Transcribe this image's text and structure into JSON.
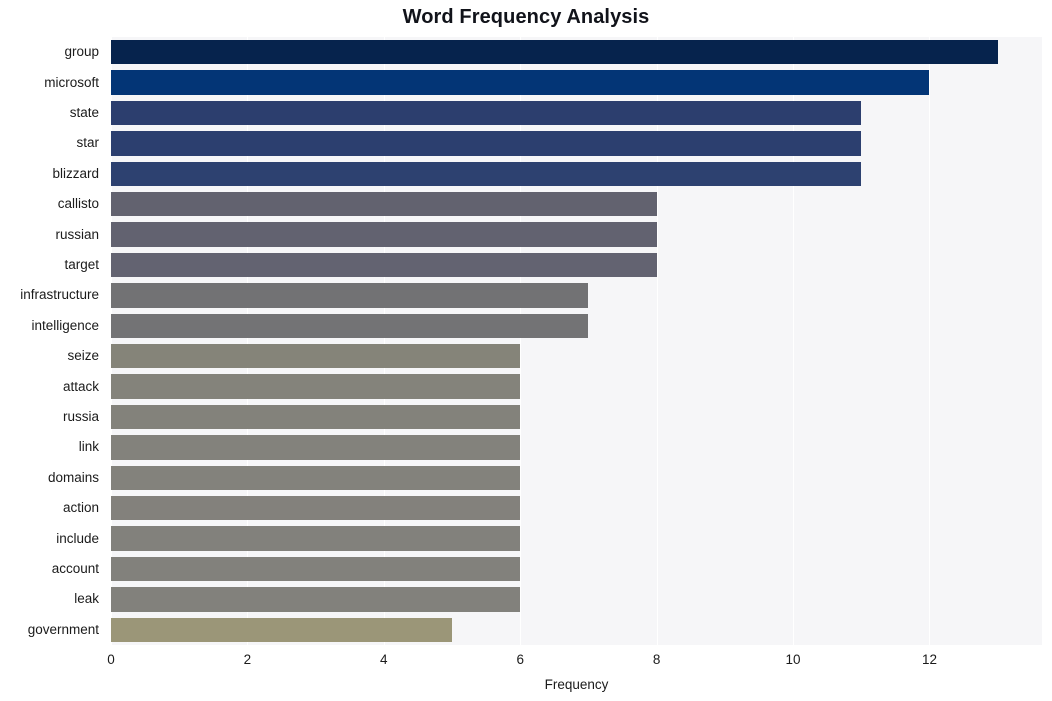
{
  "chart_data": {
    "type": "bar",
    "orientation": "horizontal",
    "title": "Word Frequency Analysis",
    "xlabel": "Frequency",
    "ylabel": "",
    "categories": [
      "group",
      "microsoft",
      "state",
      "star",
      "blizzard",
      "callisto",
      "russian",
      "target",
      "infrastructure",
      "intelligence",
      "seize",
      "attack",
      "russia",
      "link",
      "domains",
      "action",
      "include",
      "account",
      "leak",
      "government"
    ],
    "values": [
      13,
      12,
      11,
      11,
      11,
      8,
      8,
      8,
      7,
      7,
      6,
      6,
      6,
      6,
      6,
      6,
      6,
      6,
      6,
      5
    ],
    "bar_colors": [
      "#06234d",
      "#033576",
      "#2c3e6e",
      "#2c3f6f",
      "#2d4170",
      "#62626f",
      "#626270",
      "#636371",
      "#727274",
      "#737375",
      "#858479",
      "#84837b",
      "#83827b",
      "#83827c",
      "#83827c",
      "#83817c",
      "#82817c",
      "#82817c",
      "#82817c",
      "#9b9678"
    ],
    "xlim": [
      0,
      13.65
    ],
    "xticks": [
      0,
      2,
      4,
      6,
      8,
      10,
      12
    ],
    "xtick_labels": [
      "0",
      "2",
      "4",
      "6",
      "8",
      "10",
      "12"
    ],
    "grid": "vertical",
    "legend": "none",
    "plot_background": "#f6f6f8",
    "figure_background": "#ffffff"
  }
}
